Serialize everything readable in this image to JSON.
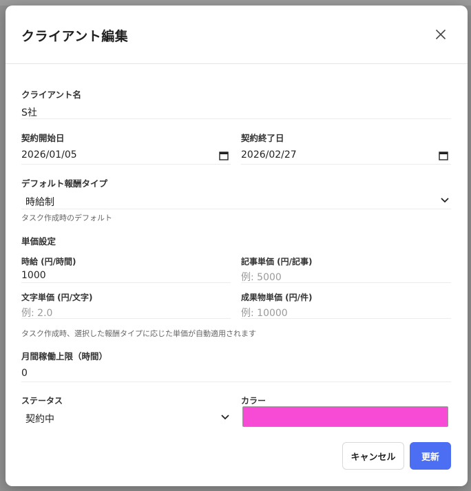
{
  "modal": {
    "title": "クライアント編集",
    "close_icon": "close-icon"
  },
  "fields": {
    "client_name": {
      "label": "クライアント名",
      "value": "S社"
    },
    "contract_start": {
      "label": "契約開始日",
      "value": "2026/01/05",
      "icon": "calendar-icon"
    },
    "contract_end": {
      "label": "契約終了日",
      "value": "2026/02/27",
      "icon": "calendar-icon"
    },
    "default_reward_type": {
      "label": "デフォルト報酬タイプ",
      "value": "時給制",
      "hint": "タスク作成時のデフォルト",
      "icon": "chevron-down-icon"
    },
    "unit_price_section": {
      "label": "単価設定",
      "hint": "タスク作成時、選択した報酬タイプに応じた単価が自動適用されます"
    },
    "hourly_rate": {
      "label": "時給 (円/時間)",
      "value": "1000"
    },
    "article_rate": {
      "label": "記事単価 (円/記事)",
      "placeholder": "例: 5000"
    },
    "char_rate": {
      "label": "文字単価 (円/文字)",
      "placeholder": "例: 2.0"
    },
    "deliverable_rate": {
      "label": "成果物単価 (円/件)",
      "placeholder": "例: 10000"
    },
    "monthly_hours_limit": {
      "label": "月間稼働上限（時間）",
      "value": "0"
    },
    "status": {
      "label": "ステータス",
      "value": "契約中",
      "icon": "chevron-down-icon"
    },
    "color": {
      "label": "カラー",
      "value": "#f74bd6"
    }
  },
  "buttons": {
    "cancel": "キャンセル",
    "update": "更新"
  },
  "colors": {
    "accent": "#4b6ef2",
    "swatch": "#f74bd6"
  }
}
